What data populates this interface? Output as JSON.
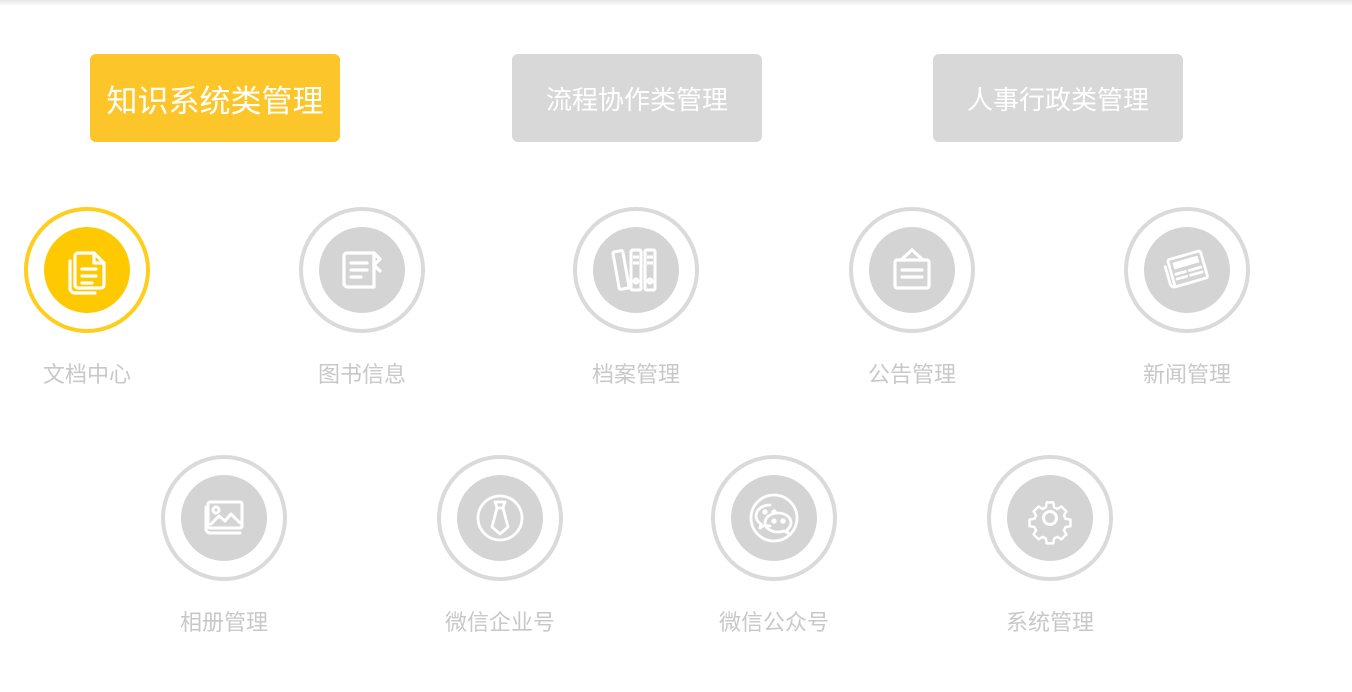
{
  "tabs": [
    {
      "label": "知识系统类管理",
      "active": true
    },
    {
      "label": "流程协作类管理",
      "active": false
    },
    {
      "label": "人事行政类管理",
      "active": false
    }
  ],
  "modules_row1": [
    {
      "label": "文档中心",
      "icon": "documents-icon",
      "active": true
    },
    {
      "label": "图书信息",
      "icon": "book-icon",
      "active": false
    },
    {
      "label": "档案管理",
      "icon": "archive-binders-icon",
      "active": false
    },
    {
      "label": "公告管理",
      "icon": "notice-board-icon",
      "active": false
    },
    {
      "label": "新闻管理",
      "icon": "newspaper-icon",
      "active": false
    }
  ],
  "modules_row2": [
    {
      "label": "相册管理",
      "icon": "photo-album-icon",
      "active": false
    },
    {
      "label": "微信企业号",
      "icon": "necktie-icon",
      "active": false
    },
    {
      "label": "微信公众号",
      "icon": "wechat-icon",
      "active": false
    },
    {
      "label": "系统管理",
      "icon": "gear-icon",
      "active": false
    }
  ],
  "colors": {
    "accent": "#fcc62a",
    "inactive_tab": "#d8d8d8",
    "inactive_icon": "#d4d4d4",
    "label_text": "#c8c8c8"
  }
}
